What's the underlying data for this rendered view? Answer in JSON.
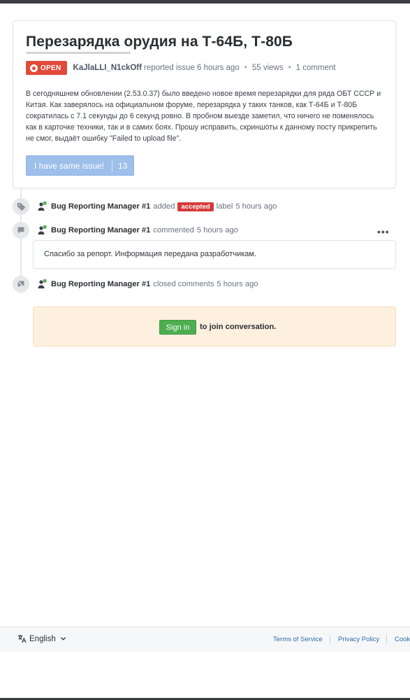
{
  "issue": {
    "title": "Перезарядка орудия на Т-64Б, Т-80Б",
    "status_label": "OPEN",
    "author": "KaJlaLLI_N1ckOff",
    "reported_text": "reported issue 6 hours ago",
    "views": "55 views",
    "comments": "1 comment",
    "description": "В сегодняшнем обновлении (2.53.0.37) было введено новое время перезарядки для ряда ОБТ СССР и Китая. Как заверялось на официальном форуме, перезарядка у таких танков, как Т-64Б и Т-80Б сократилась с 7.1 секунды до 6 секунд ровно. В пробном выезде заметил, что ничего не поменялось как в карточке техники, так и в самих боях. Прошу исправить, скриншоты к данному посту прикрепить не смог, выдаёт ошибку \"Failed to upload file\".",
    "same_issue_label": "I have same issue!",
    "same_issue_count": "13"
  },
  "timeline": [
    {
      "icon": "tag-icon",
      "user": "Bug Reporting Manager #1",
      "action": "added",
      "label": "accepted",
      "suffix": "label",
      "time": "5 hours ago"
    },
    {
      "icon": "comment-icon",
      "user": "Bug Reporting Manager #1",
      "action": "commented",
      "time": "5 hours ago",
      "more": "•••",
      "comment": "Спасибо за репорт. Информация передана разработчикам."
    },
    {
      "icon": "comments-closed-icon",
      "user": "Bug Reporting Manager #1",
      "action": "closed comments",
      "time": "5 hours ago"
    }
  ],
  "signin": {
    "button": "Sign in",
    "text": "to join conversation."
  },
  "footer": {
    "language": "English",
    "links": [
      "Terms of Service",
      "Privacy Policy",
      "Cook"
    ]
  },
  "colors": {
    "open_badge": "#e04a3a",
    "accepted_label": "#d73a3a",
    "signin_button": "#4cae4f",
    "same_issue_button": "#9dbfe9",
    "footer_link": "#2b6fa8"
  }
}
